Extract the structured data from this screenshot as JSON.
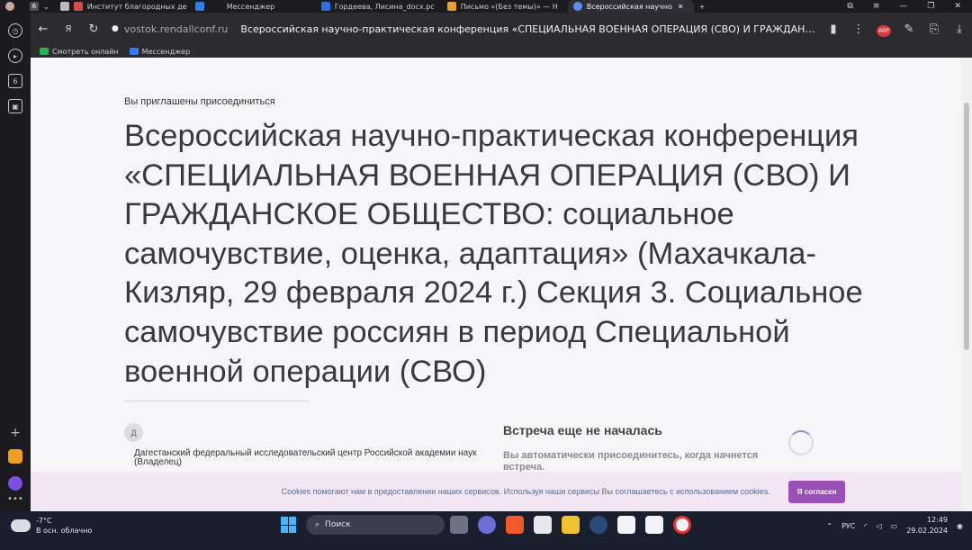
{
  "browser": {
    "tabs": [
      {
        "label": "",
        "color": "#c9a8a0"
      },
      {
        "label": "6",
        "color": "#3a3a3a"
      },
      {
        "label": "Институт благородных де",
        "color": "#d54a4a"
      },
      {
        "label": "Мессенджер",
        "color": "#2f7ff0"
      },
      {
        "label": "Гордеева, Лисина_docx.pc",
        "color": "#2f6ee8"
      },
      {
        "label": "Письмо «(Без темы)» — Н",
        "color": "#e8a12f"
      },
      {
        "label": "Всероссийская научно",
        "color": "#5b8ff0"
      }
    ],
    "new_tab": "+",
    "address": {
      "host": "vostok.rendallconf.ru",
      "title": "Всероссийская научно-практическая конференция «СПЕЦИАЛЬНАЯ ВОЕННАЯ ОПЕРАЦИЯ (СВО) И ГРАЖДАНСК..."
    },
    "bookmarks": [
      {
        "label": "Смотреть онлайн",
        "color": "#2fae4e"
      },
      {
        "label": "Мессенджер",
        "color": "#2f7ff0"
      }
    ],
    "abp_badge": "ABP"
  },
  "sidebar": {
    "badge": "6"
  },
  "page": {
    "invite": "Вы приглашены присоединиться",
    "headline": "Всероссийская научно-практическая конференция «СПЕЦИАЛЬНАЯ ВОЕННАЯ ОПЕРАЦИЯ (СВО) И ГРАЖДАНСКОЕ ОБЩЕСТВО: социальное самочувствие, оценка, адаптация» (Махачкала-Кизляр, 29 февраля 2024 г.) Секция 3. Социальное самочувствие россиян в период Специальной военной операции (СВО)",
    "avatar_letter": "Д",
    "host_name": "Дагестанский федеральный исследовательский центр Российской академии наук (Владелец)",
    "meeting_status": "Встреча еще не началась",
    "meeting_note": "Вы автоматически присоединитесь, когда начнется встреча.",
    "cookie_text": "Cookies помогают нам в предоставлении наших сервисов. Используя наши сервисы Вы соглашаетесь с использованием cookies.",
    "cookie_button": "Я согласен"
  },
  "taskbar": {
    "weather_temp": "-7°C",
    "weather_desc": "В осн. облачно",
    "search_placeholder": "Поиск",
    "lang": "РУС",
    "time": "12:49",
    "date": "29.02.2024"
  }
}
